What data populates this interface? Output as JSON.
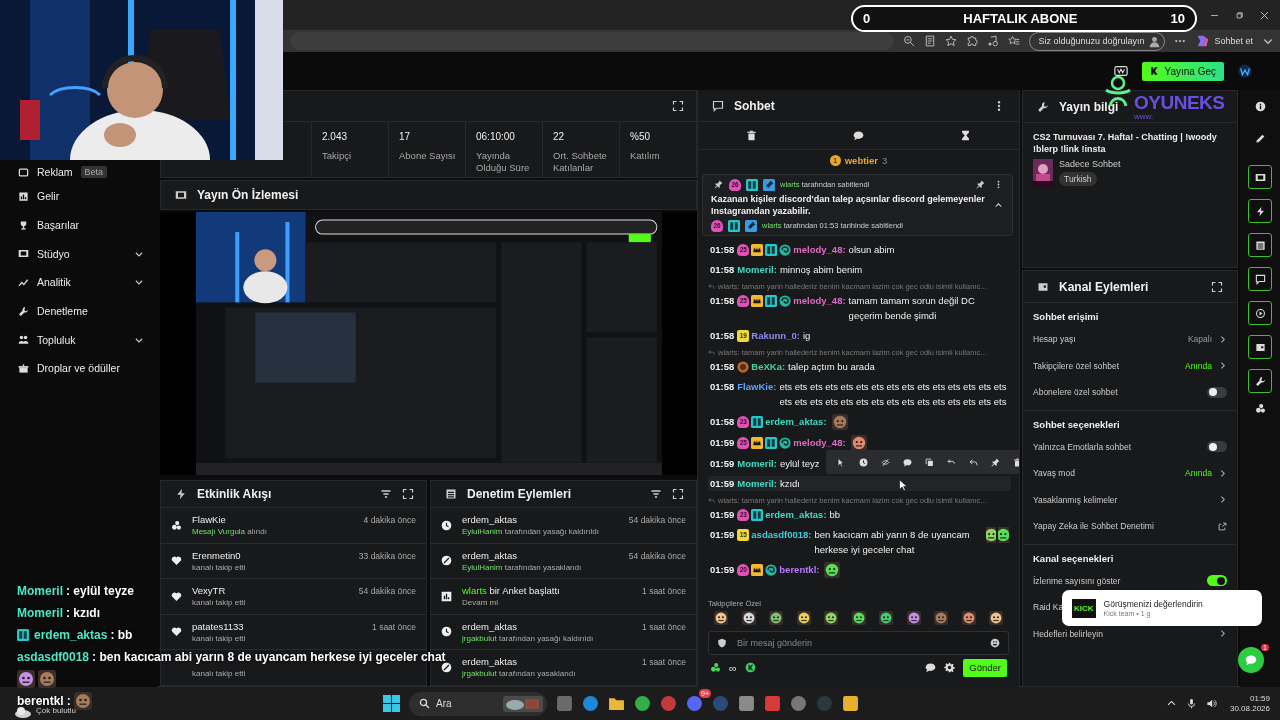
{
  "goal_bar": {
    "start": "0",
    "title": "HAFTALIK ABONE",
    "end": "10"
  },
  "browser": {
    "verify": "Siz olduğunuzu doğrulayın",
    "copilot": "Sohbet et"
  },
  "header": {
    "go_live": "Yayına Geç"
  },
  "sidebar": {
    "items": [
      {
        "label": "Reklam",
        "badge": "Beta",
        "kind": "frame",
        "expandable": false
      },
      {
        "label": "Gelir",
        "kind": "barchart",
        "expandable": false
      },
      {
        "label": "Başarılar",
        "kind": "trophy",
        "expandable": false
      },
      {
        "label": "Stüdyo",
        "kind": "film",
        "expandable": true
      },
      {
        "label": "Analitik",
        "kind": "linechart",
        "expandable": true
      },
      {
        "label": "Denetleme",
        "kind": "wrench",
        "expandable": false
      },
      {
        "label": "Topluluk",
        "kind": "people",
        "expandable": true
      },
      {
        "label": "Droplar ve ödüller",
        "kind": "gift",
        "expandable": false
      }
    ]
  },
  "stats": [
    {
      "value": "2.043",
      "label": "Takipçi"
    },
    {
      "value": "17",
      "label": "Abone Sayısı"
    },
    {
      "value": "06:10:00",
      "label": "Yayında Olduğu Süre"
    },
    {
      "value": "22",
      "label": "Ort. Sohbete Katılanlar"
    },
    {
      "value": "%50",
      "label": "Katılım"
    }
  ],
  "preview": {
    "title": "Yayın Ön İzlemesi"
  },
  "activity": {
    "title": "Etkinlik Akışı",
    "items": [
      {
        "kind": "dots",
        "user": "FlawKie",
        "highlight": "Mesajı Vurgula",
        "detail": "alındı",
        "time": "4 dakika önce"
      },
      {
        "kind": "heart",
        "user": "Erenmetin0",
        "detail": "kanalı takip etti",
        "time": "33 dakika önce"
      },
      {
        "kind": "heart",
        "user": "VexyTR",
        "detail": "kanalı takip etti",
        "time": "54 dakika önce"
      },
      {
        "kind": "heart",
        "user": "patates1133",
        "detail": "kanalı takip etti",
        "time": "1 saat önce"
      },
      {
        "kind": "covered",
        "detail": "kanalı takip etti"
      }
    ]
  },
  "moderation": {
    "title": "Denetim Eylemleri",
    "items": [
      {
        "kind": "clock",
        "title": "erdem_aktas",
        "highlight": "EylulHanim",
        "detail": "tarafından yasağı kaldırıldı",
        "time": "54 dakika önce"
      },
      {
        "kind": "ban",
        "title": "erdem_aktas",
        "highlight": "EylulHanim",
        "detail": "tarafından yasaklandı",
        "time": "54 dakika önce"
      },
      {
        "kind": "poll",
        "title_highlight": "wlarts",
        "title": "bir Anket başlattı",
        "detail": "Devam mi",
        "time": "1 saat önce"
      },
      {
        "kind": "clock",
        "title": "erdem_aktas",
        "highlight": "jrgakbulut",
        "detail": "tarafından yasağı kaldırıldı",
        "time": "1 saat önce"
      },
      {
        "kind": "ban",
        "title": "erdem_aktas",
        "highlight": "jrgakbulut",
        "detail": "tarafından yasaklandı",
        "time": "1 saat önce"
      }
    ]
  },
  "chat": {
    "title": "Sohbet",
    "top_gifter": {
      "badge": "1",
      "user": "webtier",
      "count": "3"
    },
    "pinned": {
      "badges": [
        {
          "kind": "sub",
          "text": "26"
        },
        {
          "kind": "og"
        },
        {
          "kind": "mod"
        }
      ],
      "user": "wlarts",
      "label": "tarafından sabitlendi",
      "text": "Kazanan kişiler discord'dan talep açsınlar discord gelemeyenler Instagramdan yazabilir.",
      "footer_badges": [
        {
          "kind": "sub",
          "text": "26"
        },
        {
          "kind": "og"
        },
        {
          "kind": "mod"
        }
      ],
      "footer_user": "wlarts",
      "footer": "tarafından 01:53 tarihinde sabitlendi"
    },
    "messages": [
      {
        "kind": "message",
        "time": "01:58",
        "badges": [
          {
            "kind": "sub",
            "text": "25"
          },
          {
            "kind": "crown"
          },
          {
            "kind": "og"
          },
          {
            "kind": "swirl"
          }
        ],
        "user": "melody_48:",
        "color": "#e06bc8",
        "text": "olsun abim",
        "highlighted": false
      },
      {
        "kind": "message",
        "time": "01:58",
        "user": "Momeril:",
        "color": "#3ddcc4",
        "text": "minnoş abim benim",
        "highlighted": false
      },
      {
        "kind": "reply",
        "text": "wlarts: tamam yarin hallederiz benim kacmam lazim cok gec odlu isimli kullanıc..."
      },
      {
        "kind": "message",
        "time": "01:58",
        "badges": [
          {
            "kind": "sub",
            "text": "25"
          },
          {
            "kind": "crown"
          },
          {
            "kind": "og"
          },
          {
            "kind": "swirl"
          }
        ],
        "user": "melody_48:",
        "color": "#e06bc8",
        "text": "tamam tamam sorun değil DC geçerim bende şimdi",
        "highlighted": false
      },
      {
        "kind": "message",
        "time": "01:58",
        "badges": [
          {
            "kind": "tenure",
            "text": "19"
          }
        ],
        "user": "Rakunn_0:",
        "color": "#8d8cf0",
        "text": "ig",
        "highlighted": false
      },
      {
        "kind": "reply",
        "text": "wlarts: tamam yarin hallederiz benim kacmam lazim cok gec odlu isimli kullanıc..."
      },
      {
        "kind": "message",
        "time": "01:58",
        "badges": [
          {
            "kind": "emblem"
          }
        ],
        "user": "BeXKa:",
        "color": "#45d49a",
        "text": "talep açtım bu arada",
        "highlighted": false
      },
      {
        "kind": "message",
        "time": "01:58",
        "user": "FlawKie:",
        "color": "#5aa4ff",
        "text": "ets ets ets ets ets ets ets ets ets ets ets ets ets ets ets ets ets ets ets ets ets ets ets ets ets ets ets ets ets ets",
        "highlighted": false
      },
      {
        "kind": "message",
        "time": "01:58",
        "badges": [
          {
            "kind": "sub",
            "text": "23"
          },
          {
            "kind": "og"
          }
        ],
        "user": "erdem_aktas:",
        "color": "#3ddcc4",
        "emotes": [
          {
            "kind": "picture"
          }
        ],
        "highlighted": false
      },
      {
        "kind": "message",
        "time": "01:59",
        "badges": [
          {
            "kind": "sub",
            "text": "25"
          },
          {
            "kind": "crown"
          },
          {
            "kind": "og"
          },
          {
            "kind": "swirl"
          }
        ],
        "user": "melody_48:",
        "color": "#e06bc8",
        "emotes": [
          {
            "kind": "picture"
          }
        ],
        "highlighted": false
      },
      {
        "kind": "message",
        "time": "01:59",
        "user": "Momeril:",
        "color": "#3ddcc4",
        "text": "eylül teyz",
        "highlighted": false,
        "toolbar": true
      },
      {
        "kind": "message",
        "time": "01:59",
        "user": "Momeril:",
        "color": "#3ddcc4",
        "text": "kzıdı",
        "highlighted": true
      },
      {
        "kind": "reply",
        "text": "wlarts: tamam yarin hallederiz benim kacmam lazim cok gec odlu isimli kullanıc..."
      },
      {
        "kind": "message",
        "time": "01:59",
        "badges": [
          {
            "kind": "sub",
            "text": "23"
          },
          {
            "kind": "og"
          }
        ],
        "user": "erdem_aktas:",
        "color": "#3ddcc4",
        "text": "bb",
        "highlighted": false
      },
      {
        "kind": "message",
        "time": "01:59",
        "badges": [
          {
            "kind": "tenure",
            "text": "15"
          }
        ],
        "user": "asdasdf0018:",
        "color": "#3cd0e0",
        "text": "ben kacıcam abi yarın 8 de uyancam herkese iyi geceler chat",
        "emotes": [
          {
            "kind": "picture"
          },
          {
            "kind": "picture"
          }
        ],
        "highlighted": false
      },
      {
        "kind": "message",
        "time": "01:59",
        "badges": [
          {
            "kind": "sub",
            "text": "20"
          },
          {
            "kind": "crown"
          },
          {
            "kind": "swirl"
          }
        ],
        "user": "berentkl:",
        "color": "#b57cff",
        "emotes": [
          {
            "kind": "picture"
          }
        ],
        "highlighted": false
      }
    ],
    "emote_bar": {
      "label": "Takipçilere Özel"
    },
    "composer": {
      "placeholder": "Bir mesaj gönderin",
      "count": "∞",
      "send": "Gönder"
    }
  },
  "stream_info": {
    "title": "Yayın bilgi",
    "stream_title": "CS2 Turnuvası 7. Hafta! - Chatting | !woody !blerp !link !insta",
    "category": "Sadece Sohbet",
    "tag": "Turkish"
  },
  "channel_actions": {
    "title": "Kanal Eylemleri",
    "sections": [
      {
        "title": "Sohbet erişimi",
        "rows": [
          {
            "kind": "value",
            "label": "Hesap yaşı",
            "value": "Kapalı",
            "active": false
          },
          {
            "kind": "value",
            "label": "Takipçilere özel sohbet",
            "value": "Anında",
            "active": true
          },
          {
            "kind": "toggle",
            "label": "Abonelere özel sohbet",
            "on": false
          }
        ]
      },
      {
        "title": "Sohbet seçenekleri",
        "rows": [
          {
            "kind": "toggle",
            "label": "Yalnızca Emotlarla sohbet",
            "on": false
          },
          {
            "kind": "value",
            "label": "Yavaş mod",
            "value": "Anında",
            "active": true
          },
          {
            "kind": "link",
            "label": "Yasaklanmış kelimeler"
          },
          {
            "kind": "external",
            "label": "Yapay Zeka ile Sohbet Denetimi"
          }
        ]
      },
      {
        "title": "Kanal seçenekleri",
        "rows": [
          {
            "kind": "toggle",
            "label": "İzlenme sayısını göster",
            "on": true
          },
          {
            "kind": "plain",
            "label": "Raid Ka"
          },
          {
            "kind": "link",
            "label": "Hedefleri belirleyin"
          }
        ]
      }
    ]
  },
  "toast": {
    "logo": "KICK",
    "title": "Görüşmenizi değerlendirin",
    "subtitle": "Kick team • 1 g"
  },
  "help_badge": "1",
  "overlay": {
    "logo": "OYUNEKS",
    "logo_sub": "www.",
    "chat": [
      {
        "user": "Momeril",
        "text": ": eylül teyze"
      },
      {
        "user": "Momeril",
        "text": ": kzıdı"
      },
      {
        "badge": true,
        "user": "erdem_aktas",
        "text": ": bb"
      },
      {
        "user": "asdasdf0018",
        "text": ": ben kacıcam abi yarın 8 de uyancam herkese iyi geceler chat"
      },
      {
        "emotes": [
          {
            "kind": "picture"
          },
          {
            "kind": "picture"
          }
        ]
      },
      {
        "user": "berentkl",
        "plain": true,
        "text": ":",
        "emotes": [
          {
            "kind": "picture"
          }
        ]
      }
    ]
  },
  "taskbar": {
    "weather": "Çok bulutlu",
    "search": "Ara",
    "app_badge": "9+",
    "time": "01:59",
    "date": "30.08.2026"
  }
}
